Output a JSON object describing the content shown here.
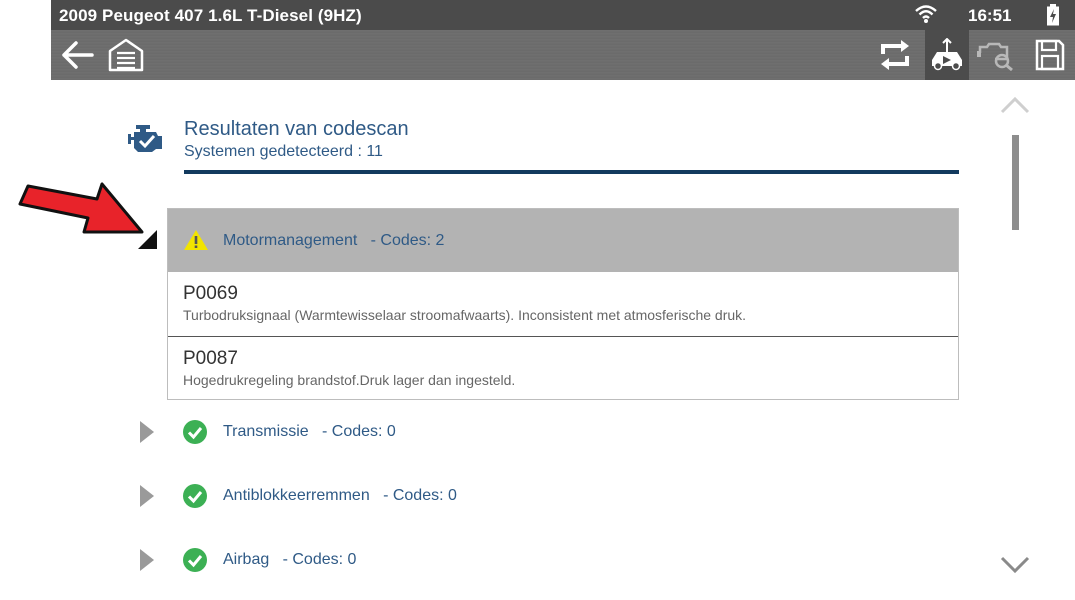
{
  "status_bar": {
    "vehicle_title": "2009 Peugeot 407 1.6L T-Diesel (9HZ)",
    "time": "16:51"
  },
  "toolbar": {
    "icons": [
      "back-arrow-icon",
      "garage-home-icon",
      "refresh-swap-icon",
      "vehicle-connection-icon",
      "vehicle-scan-icon",
      "save-floppy-icon"
    ]
  },
  "header": {
    "title": "Resultaten van codescan",
    "subtitle": "Systemen gedetecteerd : 11"
  },
  "groups": [
    {
      "name": "Motormanagement",
      "codes_label": "- Codes: 2",
      "status": "warning",
      "expanded": true,
      "codes": [
        {
          "code": "P0069",
          "description": "Turbodruksignaal (Warmtewisselaar stroomafwaarts). Inconsistent met atmosferische druk."
        },
        {
          "code": "P0087",
          "description": "Hogedrukregeling brandstof.Druk lager dan ingesteld."
        }
      ]
    },
    {
      "name": "Transmissie",
      "codes_label": "- Codes: 0",
      "status": "ok",
      "expanded": false
    },
    {
      "name": "Antiblokkeerremmen",
      "codes_label": "- Codes: 0",
      "status": "ok",
      "expanded": false
    },
    {
      "name": "Airbag",
      "codes_label": "- Codes: 0",
      "status": "ok",
      "expanded": false
    }
  ],
  "colors": {
    "accent_text": "#2f5a86",
    "header_rule": "#123a5e",
    "ok_green": "#3cb054",
    "warning_yellow": "#f2e400",
    "annotation_arrow": "#e8232a"
  }
}
